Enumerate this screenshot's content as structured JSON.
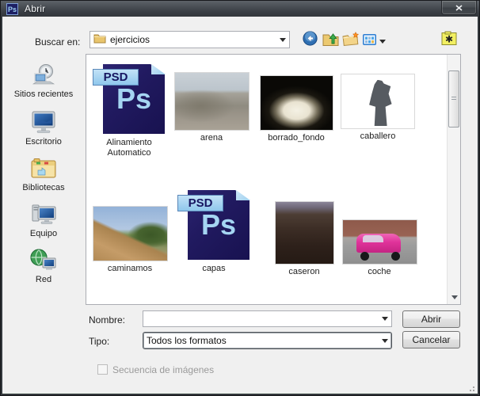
{
  "window": {
    "title": "Abrir",
    "app_badge": "Ps"
  },
  "toolbar": {
    "look_in_label": "Buscar en:",
    "location_value": "ejercicios",
    "icons": [
      "back-circle-icon",
      "folder-up-icon",
      "new-folder-icon",
      "view-grid-icon",
      "yellow-asterisk-folder-icon"
    ]
  },
  "sidebar": {
    "items": [
      {
        "label": "Sitios recientes",
        "icon": "recent-places-icon"
      },
      {
        "label": "Escritorio",
        "icon": "desktop-icon"
      },
      {
        "label": "Bibliotecas",
        "icon": "libraries-icon"
      },
      {
        "label": "Equipo",
        "icon": "computer-icon"
      },
      {
        "label": "Red",
        "icon": "network-icon"
      }
    ]
  },
  "files": [
    {
      "name": "Alinamiento Automatico",
      "type": "psd",
      "badge": "PSD",
      "glyph": "Ps"
    },
    {
      "name": "arena",
      "type": "photo",
      "depicts": "beach dune"
    },
    {
      "name": "borrado_fondo",
      "type": "photo",
      "depicts": "white dome at night"
    },
    {
      "name": "caballero",
      "type": "photo",
      "depicts": "equestrian statue and clouds"
    },
    {
      "name": "caminamos",
      "type": "photo",
      "depicts": "dirt path with trees"
    },
    {
      "name": "capas",
      "type": "psd",
      "badge": "PSD",
      "glyph": "Ps"
    },
    {
      "name": "caseron",
      "type": "photo",
      "depicts": "dark brick house"
    },
    {
      "name": "coche",
      "type": "photo",
      "depicts": "pink taxi on street"
    }
  ],
  "footer": {
    "name_label": "Nombre:",
    "name_value": "",
    "type_label": "Tipo:",
    "type_value": "Todos los formatos",
    "open_button": "Abrir",
    "cancel_button": "Cancelar",
    "sequence_checkbox_label": "Secuencia de imágenes",
    "sequence_checkbox_checked": false,
    "sequence_checkbox_enabled": false
  },
  "colors": {
    "titlebar": "#44484e",
    "dialog_bg": "#f0f0f0",
    "psd_navy": "#1c1650",
    "psd_light_blue": "#a5d5f2",
    "taxi_pink": "#e0339a"
  }
}
